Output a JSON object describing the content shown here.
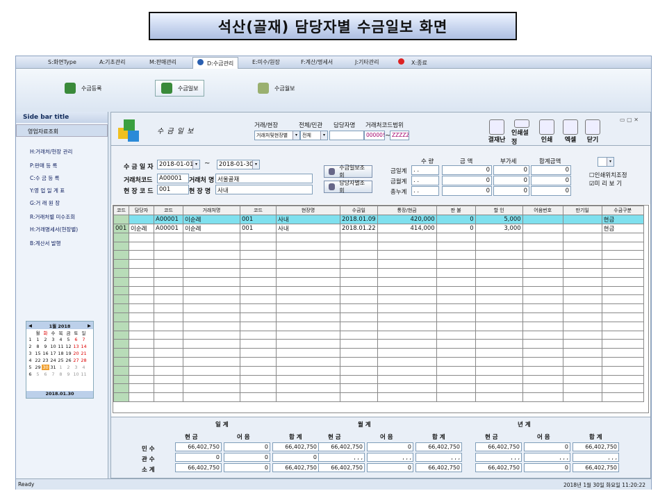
{
  "banner": "석산(골재) 담당자별 수금일보 화면",
  "menu": [
    "S:화면Type",
    "A:기초관리",
    "M:판매관리",
    "D:수금관리",
    "E:미수/원장",
    "F:계산/명세서",
    "J:기타관리",
    "X:종료"
  ],
  "ribbon": [
    "수금등록",
    "수금일보",
    "수금월보"
  ],
  "sidebar": {
    "title": "Side bar title",
    "section": "영업자료조회",
    "items": [
      "H:거래처/현장 관리",
      "P:판매 등 록",
      "C:수 금 등 록",
      "Y:영 업 일 계 표",
      "G:거 래 원 장",
      "R:거래처별 미수조회",
      "H:거래명세서(현장별)",
      "B:계산서 발행"
    ]
  },
  "calendar": {
    "month": "1월 2018",
    "prev": "◀",
    "next": "▶",
    "weekdays": [
      "월",
      "화",
      "수",
      "목",
      "금",
      "토",
      "일"
    ],
    "weeks": [
      [
        "1",
        "1",
        "2",
        "3",
        "4",
        "5",
        "6",
        "7"
      ],
      [
        "2",
        "8",
        "9",
        "10",
        "11",
        "12",
        "13",
        "14"
      ],
      [
        "3",
        "15",
        "16",
        "17",
        "18",
        "19",
        "20",
        "21"
      ],
      [
        "4",
        "22",
        "23",
        "24",
        "25",
        "26",
        "27",
        "28"
      ],
      [
        "5",
        "29",
        "30",
        "31",
        "1",
        "2",
        "3",
        "4"
      ],
      [
        "6",
        "5",
        "6",
        "7",
        "8",
        "9",
        "10",
        "11"
      ]
    ],
    "today": "2018.01.30"
  },
  "form": {
    "title": "수 금 일 보",
    "f1": "거래/현장",
    "f1v": "거래처및현장별",
    "f2": "전체/민관",
    "f2v": "전체",
    "f3": "담당자명",
    "f4": "거래처코드범위",
    "f4a": "00000!",
    "f4b": "ZZZZZ",
    "date_lbl": "수 금 일 자",
    "date_from": "2018-01-01",
    "date_to": "2018-01-30",
    "tilde": "~",
    "c_lbl": "거래처코드",
    "c_val": "A00001",
    "cn_lbl": "거래처 명",
    "cn_val": "서울골재",
    "s_lbl": "현 장 코 드",
    "s_val": "001",
    "sn_lbl": "현 장 명",
    "sn_val": "사내",
    "btn1": "수금일보조회",
    "btn2": "담당자별조회"
  },
  "tools": [
    "결재난",
    "인쇄설정",
    "인쇄",
    "엑셀",
    "닫기"
  ],
  "totals": {
    "heads": [
      "수 량",
      "금 액",
      "부가세",
      "합계금액"
    ],
    "rows": [
      {
        "label": "금일계",
        "q": ". .",
        "a": "0",
        "v": "0",
        "t": "0"
      },
      {
        "label": "금월계",
        "q": ". .",
        "a": "0",
        "v": "0",
        "t": "0"
      },
      {
        "label": "총누계",
        "q": ". .",
        "a": "0",
        "v": "0",
        "t": "0"
      }
    ]
  },
  "opts": {
    "o1": "인쇄위치조정",
    "o2": "미 리 보 기",
    "c1": "☐",
    "c2": "☑"
  },
  "grid": {
    "cols": [
      "코드",
      "담당자",
      "코드",
      "거래처명",
      "코드",
      "현장명",
      "수금일",
      "통장/현금",
      "판 불",
      "할 인",
      "어음번호",
      "만기일",
      "수금구분"
    ],
    "rows": [
      [
        "",
        "",
        "A00001",
        "이순례",
        "001",
        "사내",
        "2018.01.09",
        "420,000",
        "0",
        "5,000",
        "",
        "",
        "현금"
      ],
      [
        "001",
        "이순례",
        "A00001",
        "이순례",
        "001",
        "사내",
        "2018.01.22",
        "414,000",
        "0",
        "3,000",
        "",
        "",
        "현금"
      ]
    ]
  },
  "summary": {
    "groups": [
      "일 계",
      "월 계",
      "년 계"
    ],
    "sub": [
      "현 금",
      "어 음",
      "합 계"
    ],
    "rowlbl": [
      "민 수",
      "관 수",
      "소 계"
    ],
    "ilgye": [
      [
        "66,402,750",
        "0",
        "66,402,750"
      ],
      [
        "0",
        "0",
        "0"
      ],
      [
        "66,402,750",
        "0",
        "66,402,750"
      ]
    ],
    "wolgye": [
      [
        "66,402,750",
        "0",
        "66,402,750"
      ],
      [
        ", , ,",
        ", , ,",
        ", , ,"
      ],
      [
        "66,402,750",
        "0",
        "66,402,750"
      ]
    ],
    "nyeongye": [
      [
        "66,402,750",
        "0",
        "66,402,750"
      ],
      [
        ", , ,",
        ", , ,",
        ", , ,"
      ],
      [
        "66,402,750",
        "0",
        "66,402,750"
      ]
    ]
  },
  "status": {
    "left": "Ready",
    "right": "2018년 1월 30일 화요일 11:20:22"
  }
}
